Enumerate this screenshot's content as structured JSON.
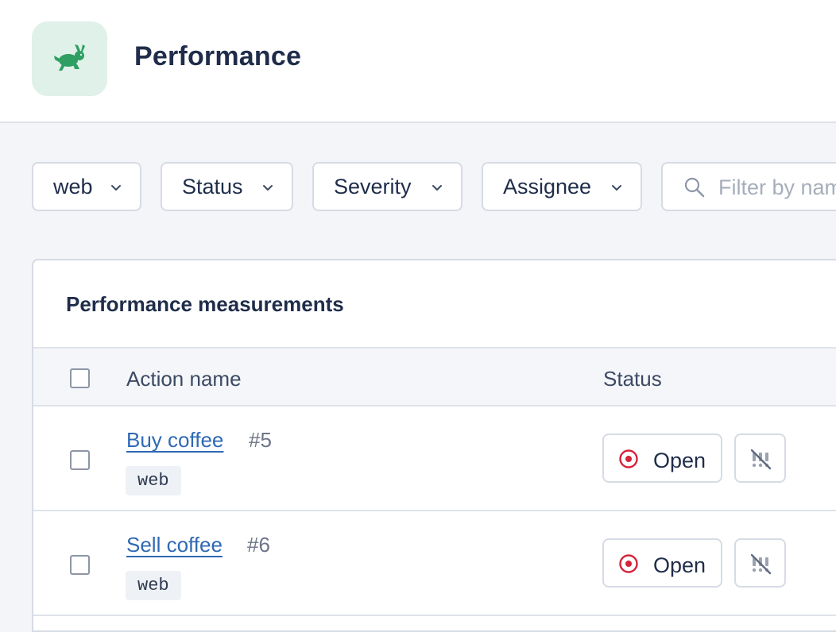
{
  "header": {
    "title": "Performance",
    "icon": "rabbit-icon",
    "icon_color": "#2f9e63"
  },
  "filters": {
    "platform_label": "web",
    "status_label": "Status",
    "severity_label": "Severity",
    "assignee_label": "Assignee",
    "search_placeholder": "Filter by name"
  },
  "table": {
    "title": "Performance measurements",
    "columns": [
      "Action name",
      "Status"
    ],
    "rows": [
      {
        "name": "Buy coffee",
        "number": "#5",
        "tag": "web",
        "status": "Open"
      },
      {
        "name": "Sell coffee",
        "number": "#6",
        "tag": "web",
        "status": "Open"
      }
    ]
  },
  "colors": {
    "accent_link": "#2f69b3",
    "status_open": "#d3243a",
    "text_primary": "#1f2d4a",
    "border": "#d6dbe4"
  }
}
